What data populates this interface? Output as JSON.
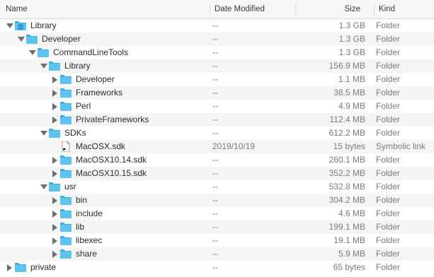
{
  "columns": {
    "name": "Name",
    "date": "Date Modified",
    "size": "Size",
    "kind": "Kind"
  },
  "colors": {
    "folder": "#5ec3ee",
    "folder_tab": "#3eaee3",
    "stripe": "#f4f5f5"
  },
  "rows": [
    {
      "name": "Library",
      "date": "--",
      "size": "1.3 GB",
      "kind": "Folder",
      "depth": 0,
      "expanded": true,
      "icon": "library-folder-icon"
    },
    {
      "name": "Developer",
      "date": "--",
      "size": "1.3 GB",
      "kind": "Folder",
      "depth": 1,
      "expanded": true,
      "icon": "folder-icon"
    },
    {
      "name": "CommandLineTools",
      "date": "--",
      "size": "1.3 GB",
      "kind": "Folder",
      "depth": 2,
      "expanded": true,
      "icon": "folder-icon"
    },
    {
      "name": "Library",
      "date": "--",
      "size": "156.9 MB",
      "kind": "Folder",
      "depth": 3,
      "expanded": true,
      "icon": "folder-icon"
    },
    {
      "name": "Developer",
      "date": "--",
      "size": "1.1 MB",
      "kind": "Folder",
      "depth": 4,
      "expanded": false,
      "icon": "folder-icon"
    },
    {
      "name": "Frameworks",
      "date": "--",
      "size": "38.5 MB",
      "kind": "Folder",
      "depth": 4,
      "expanded": false,
      "icon": "folder-icon"
    },
    {
      "name": "Perl",
      "date": "--",
      "size": "4.9 MB",
      "kind": "Folder",
      "depth": 4,
      "expanded": false,
      "icon": "folder-icon"
    },
    {
      "name": "PrivateFrameworks",
      "date": "--",
      "size": "112.4 MB",
      "kind": "Folder",
      "depth": 4,
      "expanded": false,
      "icon": "folder-icon"
    },
    {
      "name": "SDKs",
      "date": "--",
      "size": "612.2 MB",
      "kind": "Folder",
      "depth": 3,
      "expanded": true,
      "icon": "folder-icon"
    },
    {
      "name": "MacOSX.sdk",
      "date": "2019/10/19",
      "size": "15 bytes",
      "kind": "Symbolic link",
      "depth": 4,
      "expanded": null,
      "icon": "alias-file-icon"
    },
    {
      "name": "MacOSX10.14.sdk",
      "date": "--",
      "size": "260.1 MB",
      "kind": "Folder",
      "depth": 4,
      "expanded": false,
      "icon": "folder-icon"
    },
    {
      "name": "MacOSX10.15.sdk",
      "date": "--",
      "size": "352.2 MB",
      "kind": "Folder",
      "depth": 4,
      "expanded": false,
      "icon": "folder-icon"
    },
    {
      "name": "usr",
      "date": "--",
      "size": "532.8 MB",
      "kind": "Folder",
      "depth": 3,
      "expanded": true,
      "icon": "folder-icon"
    },
    {
      "name": "bin",
      "date": "--",
      "size": "304.2 MB",
      "kind": "Folder",
      "depth": 4,
      "expanded": false,
      "icon": "folder-icon"
    },
    {
      "name": "include",
      "date": "--",
      "size": "4.6 MB",
      "kind": "Folder",
      "depth": 4,
      "expanded": false,
      "icon": "folder-icon"
    },
    {
      "name": "lib",
      "date": "--",
      "size": "199.1 MB",
      "kind": "Folder",
      "depth": 4,
      "expanded": false,
      "icon": "folder-icon"
    },
    {
      "name": "libexec",
      "date": "--",
      "size": "19.1 MB",
      "kind": "Folder",
      "depth": 4,
      "expanded": false,
      "icon": "folder-icon"
    },
    {
      "name": "share",
      "date": "--",
      "size": "5.9 MB",
      "kind": "Folder",
      "depth": 4,
      "expanded": false,
      "icon": "folder-icon"
    },
    {
      "name": "private",
      "date": "--",
      "size": "65 bytes",
      "kind": "Folder",
      "depth": 0,
      "expanded": false,
      "icon": "folder-icon"
    }
  ]
}
